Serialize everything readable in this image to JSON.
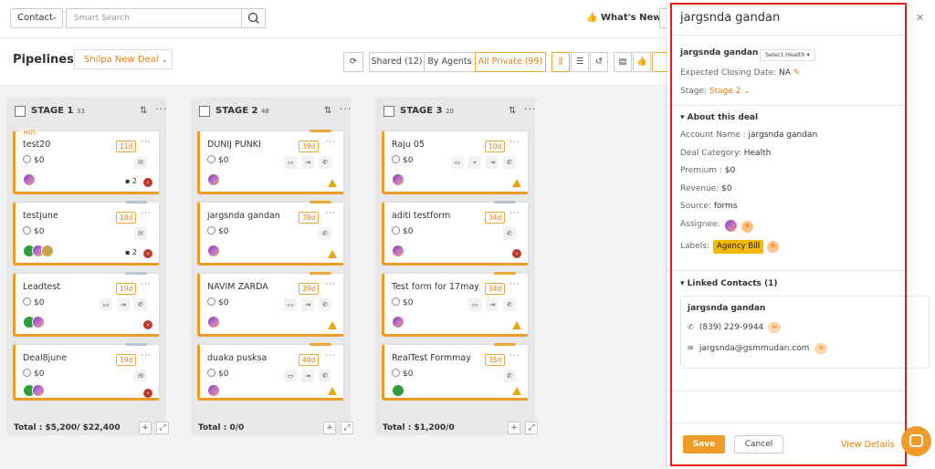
{
  "topbar": {
    "contact_select": "Contact",
    "search_placeholder": "Smart Search",
    "whats_new": "What's New"
  },
  "pipelines": {
    "title": "Pipelines",
    "deal_selector": "Shilpa New Deal",
    "shared": "Shared (12)",
    "by_agents": "By Agents",
    "all_private": "All Private (99)"
  },
  "board": {
    "columns": [
      {
        "title": "STAGE 1",
        "count": "33",
        "total": "Total : $5,200/ $22,400",
        "cards": [
          {
            "name": "test20",
            "days": "11d",
            "amount": "$0",
            "hot": "HOT",
            "comments": "2"
          },
          {
            "name": "testjune",
            "days": "18d",
            "amount": "$0",
            "comments": "2"
          },
          {
            "name": "Leadtest",
            "days": "19d",
            "amount": "$0"
          },
          {
            "name": "Deal8june",
            "days": "19d",
            "amount": "$0"
          }
        ]
      },
      {
        "title": "STAGE 2",
        "count": "48",
        "total": "Total : 0/0",
        "cards": [
          {
            "name": "DUNIJ PUNKI",
            "days": "39d",
            "amount": "$0"
          },
          {
            "name": "jargsnda gandan",
            "days": "39d",
            "amount": "$0"
          },
          {
            "name": "NAVIM ZARDA",
            "days": "39d",
            "amount": "$0"
          },
          {
            "name": "duaka pusksa",
            "days": "40d",
            "amount": "$0"
          }
        ]
      },
      {
        "title": "STAGE 3",
        "count": "20",
        "total": "Total : $1,200/0",
        "cards": [
          {
            "name": "Raju 05",
            "days": "10d",
            "amount": "$0"
          },
          {
            "name": "aditi testform",
            "days": "34d",
            "amount": "$0"
          },
          {
            "name": "Test form for 17may",
            "days": "34d",
            "amount": "$0"
          },
          {
            "name": "RealTest Formmay",
            "days": "35d",
            "amount": "$0"
          }
        ]
      }
    ]
  },
  "panel": {
    "title": "jargsnda gandan",
    "contact_name": "jargsnda gandan",
    "health_select": "Select Health",
    "closing_label": "Expected Closing Date:",
    "closing_value": "NA",
    "stage_label": "Stage:",
    "stage_value": "Stage 2",
    "about_heading": "About this deal",
    "fields": [
      {
        "label": "Account Name :",
        "value": "jargsnda gandan"
      },
      {
        "label": "Deal Category:",
        "value": "Health"
      },
      {
        "label": "Premium :",
        "value": "$0"
      },
      {
        "label": "Revenue:",
        "value": "$0"
      },
      {
        "label": "Source:",
        "value": "forms"
      }
    ],
    "assignee_label": "Assignee:",
    "labels_label": "Labels:",
    "label_chip": "Agency Bill",
    "linked_heading": "Linked Contacts (1)",
    "linked_contact": {
      "name": "jargsnda gandan",
      "phone": "(839) 229-9944",
      "email": "jargsnda@gsmmudan.com"
    },
    "save": "Save",
    "cancel": "Cancel",
    "view_details": "View Details"
  },
  "colors": {
    "accent": "#f09b28",
    "highlight_border": "#e01e1e",
    "label_chip": "#f5b800"
  }
}
